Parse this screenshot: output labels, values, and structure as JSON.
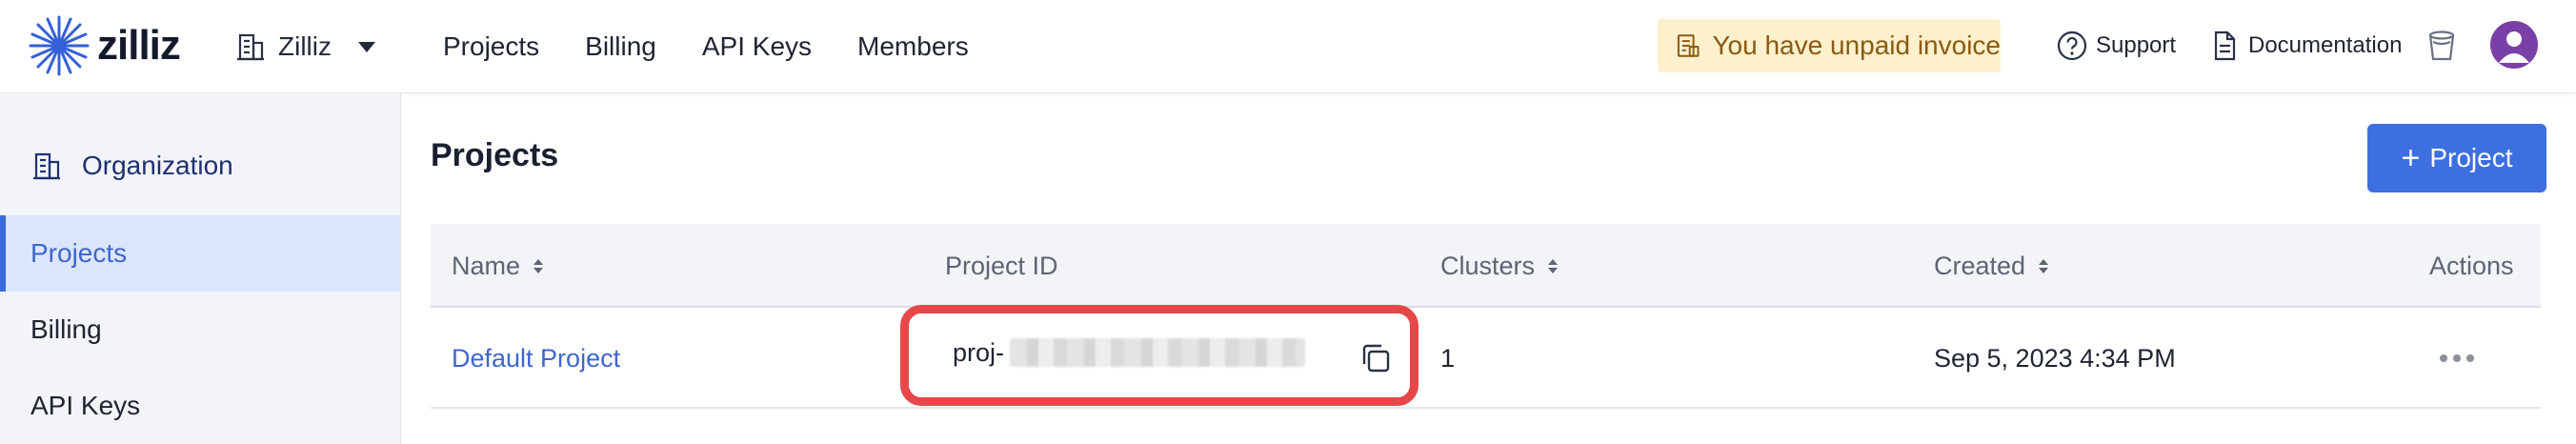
{
  "header": {
    "logo_text": "zilliz",
    "org_name": "Zilliz",
    "nav": [
      "Projects",
      "Billing",
      "API Keys",
      "Members"
    ],
    "invoice_text": "You have unpaid invoice",
    "support_label": "Support",
    "docs_label": "Documentation"
  },
  "sidebar": {
    "org_label": "Organization",
    "items": [
      {
        "label": "Projects",
        "active": true
      },
      {
        "label": "Billing",
        "active": false
      },
      {
        "label": "API Keys",
        "active": false
      }
    ]
  },
  "main": {
    "title": "Projects",
    "new_button_label": "Project",
    "new_button_icon": "plus-icon",
    "table": {
      "columns": [
        {
          "label": "Name",
          "sortable": true
        },
        {
          "label": "Project ID",
          "sortable": false
        },
        {
          "label": "Clusters",
          "sortable": true
        },
        {
          "label": "Created",
          "sortable": true
        },
        {
          "label": "Actions",
          "sortable": false
        }
      ],
      "rows": [
        {
          "name": "Default Project",
          "project_id_prefix": "proj-",
          "clusters": "1",
          "created": "Sep 5, 2023 4:34 PM"
        }
      ]
    }
  },
  "colors": {
    "accent": "#3e6fe0",
    "sidebar_active_bg": "#dbe6fb",
    "invoice_bg": "#fdf0cc",
    "invoice_text": "#8a5a12",
    "highlight": "#e8474a",
    "avatar": "#7b3fa8"
  },
  "icons": {
    "logo": "zilliz-star-icon",
    "org": "building-icon",
    "invoice": "invoice-icon",
    "support": "help-circle-icon",
    "docs": "document-icon",
    "trash": "trash-icon",
    "copy": "copy-icon",
    "more": "more-horizontal-icon"
  }
}
